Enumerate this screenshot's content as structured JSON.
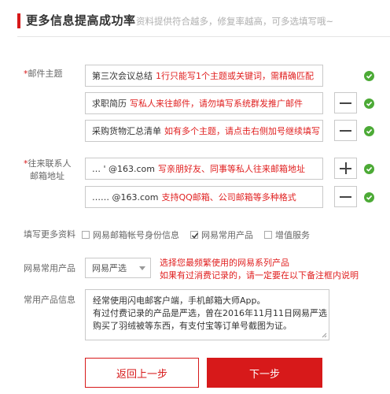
{
  "header": {
    "title": "更多信息提高成功率",
    "subtitle": "资料提供符合越多，修复率越高，可多选填写哦~"
  },
  "subject": {
    "label_required": "*",
    "label": "邮件主题",
    "rows": [
      {
        "value": "第三次会议总结",
        "hint": "1行只能写1个主题或关键词，需精确匹配"
      },
      {
        "value": "求职简历",
        "hint": "写私人来往邮件，请勿填写系统群发推广邮件"
      },
      {
        "value": "采购货物汇总清单",
        "hint": "如有多个主题，请点击右侧加号继续填写"
      }
    ]
  },
  "contact": {
    "label_required": "*",
    "label_line1": "往来联系人",
    "label_line2": "邮箱地址",
    "rows": [
      {
        "value": "…   ' @163.com",
        "hint": "写亲朋好友、同事等私人往来邮箱地址"
      },
      {
        "value": "…… @163.com",
        "hint": "支持QQ邮箱、公司邮箱等多种格式"
      }
    ]
  },
  "more": {
    "label": "填写更多资料",
    "options": [
      {
        "label": "网易邮箱帐号身份信息",
        "checked": false
      },
      {
        "label": "网易常用产品",
        "checked": true
      },
      {
        "label": "增值服务",
        "checked": false
      }
    ]
  },
  "product": {
    "label": "网易常用产品",
    "selected": "网易严选",
    "note_line1": "选择您最频繁使用的网易系列产品",
    "note_line2": "如果有过消费记录的，请一定要在以下备注框内说明"
  },
  "info": {
    "label": "常用产品信息",
    "lines": [
      "经常使用闪电邮客户端，手机邮箱大师App。",
      "有过付费记录的产品是严选，曾在2016年11月11日网易严选",
      "购买了羽绒被等东西，有支付宝等订单号截图为证。"
    ]
  },
  "buttons": {
    "back": "返回上一步",
    "next": "下一步"
  },
  "colors": {
    "accent": "#d7191a",
    "hint": "#e02020",
    "success": "#4caa36"
  }
}
